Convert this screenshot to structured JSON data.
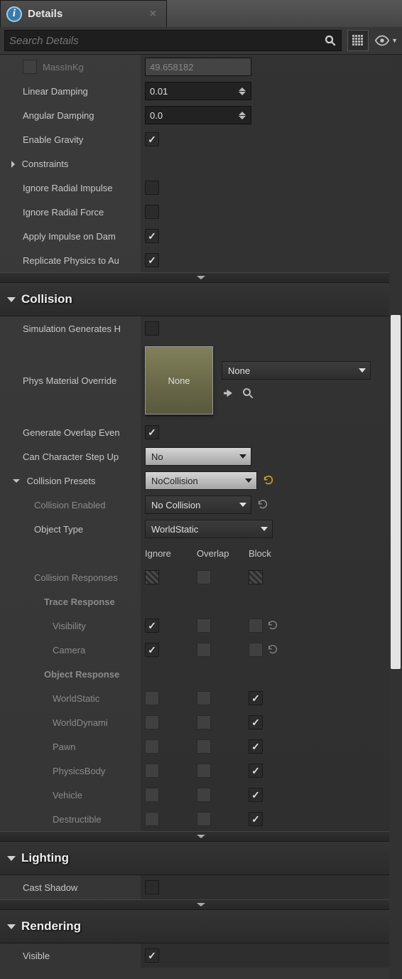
{
  "tab": {
    "title": "Details"
  },
  "search": {
    "placeholder": "Search Details"
  },
  "physics": {
    "mass_label": "MassInKg",
    "mass_value": "49.658182",
    "linear_damping_label": "Linear Damping",
    "linear_damping_value": "0.01",
    "angular_damping_label": "Angular Damping",
    "angular_damping_value": "0.0",
    "enable_gravity_label": "Enable Gravity",
    "constraints_label": "Constraints",
    "ignore_radial_impulse_label": "Ignore Radial Impulse",
    "ignore_radial_force_label": "Ignore Radial Force",
    "apply_impulse_label": "Apply Impulse on Dam",
    "replicate_phys_label": "Replicate Physics to Au"
  },
  "collision": {
    "header": "Collision",
    "sim_gen_hits_label": "Simulation Generates H",
    "phys_mat_override_label": "Phys Material Override",
    "phys_mat_thumb_text": "None",
    "phys_mat_value": "None",
    "gen_overlap_label": "Generate Overlap Even",
    "can_step_label": "Can Character Step Up",
    "can_step_value": "No",
    "presets_label": "Collision Presets",
    "presets_value": "NoCollision",
    "collision_enabled_label": "Collision Enabled",
    "collision_enabled_value": "No Collision",
    "object_type_label": "Object Type",
    "object_type_value": "WorldStatic",
    "resp_ignore": "Ignore",
    "resp_overlap": "Overlap",
    "resp_block": "Block",
    "collision_responses_label": "Collision Responses",
    "trace_response_label": "Trace Response",
    "visibility_label": "Visibility",
    "camera_label": "Camera",
    "object_response_label": "Object Response",
    "channels": [
      {
        "label": "WorldStatic",
        "state": "block"
      },
      {
        "label": "WorldDynami",
        "state": "block"
      },
      {
        "label": "Pawn",
        "state": "block"
      },
      {
        "label": "PhysicsBody",
        "state": "block"
      },
      {
        "label": "Vehicle",
        "state": "block"
      },
      {
        "label": "Destructible",
        "state": "block"
      }
    ]
  },
  "lighting": {
    "header": "Lighting",
    "cast_shadow_label": "Cast Shadow"
  },
  "rendering": {
    "header": "Rendering",
    "visible_label": "Visible"
  }
}
